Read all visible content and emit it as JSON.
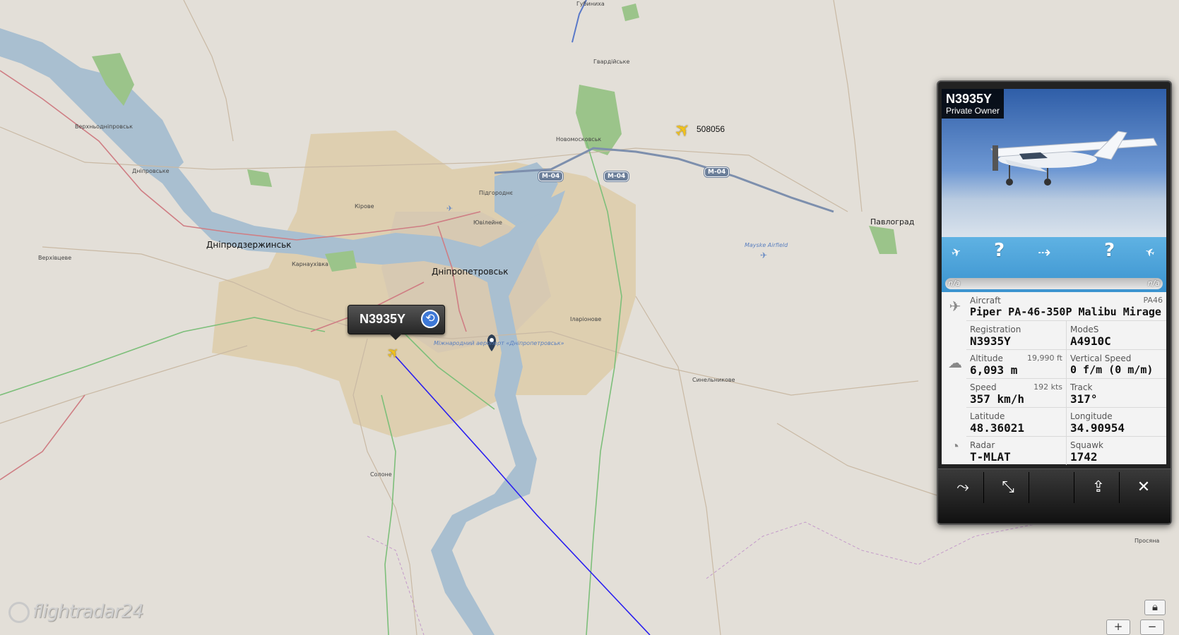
{
  "brand": {
    "logo_text": "flightradar24"
  },
  "map": {
    "cities": [
      {
        "name": "Губиниха"
      },
      {
        "name": "Гвардійське"
      },
      {
        "name": "Новомосковськ"
      },
      {
        "name": "Верхньодніпровськ"
      },
      {
        "name": "Дніпровське"
      },
      {
        "name": "Підгороднє"
      },
      {
        "name": "Кірове"
      },
      {
        "name": "Ювілейне"
      },
      {
        "name": "Дніпродзержинськ"
      },
      {
        "name": "Карнаухівка"
      },
      {
        "name": "Дніпропетровськ"
      },
      {
        "name": "Верхівцеве"
      },
      {
        "name": "Іларіонове"
      },
      {
        "name": "Павлоград"
      },
      {
        "name": "Синельникове"
      },
      {
        "name": "Солоне"
      },
      {
        "name": "Просяна"
      }
    ],
    "airfield": "Mayske Airfield",
    "airport": "Міжнародний аеропорт «Дніпропетровськ»",
    "road_shields": [
      "M-04",
      "M-04",
      "M-04"
    ]
  },
  "flights": {
    "other_callsign": "508056",
    "selected_callout": "N3935Y"
  },
  "panel": {
    "registration_title": "N3935Y",
    "owner": "Private Owner",
    "origin": "?",
    "destination": "?",
    "origin_time": "n/a",
    "dest_time": "n/a",
    "aircraft_label": "Aircraft",
    "aircraft_code": "PA46",
    "aircraft_name": "Piper PA-46-350P Malibu Mirage",
    "registration_label": "Registration",
    "registration": "N3935Y",
    "modes_label": "ModeS",
    "modes": "A4910C",
    "altitude_label": "Altitude",
    "altitude_ft": "19,990 ft",
    "altitude_m": "6,093 m",
    "vspeed_label": "Vertical Speed",
    "vspeed": "0 f/m (0 m/m)",
    "speed_label": "Speed",
    "speed_kts": "192 kts",
    "speed_kmh": "357 km/h",
    "track_label": "Track",
    "track": "317°",
    "lat_label": "Latitude",
    "lat": "48.36021",
    "lon_label": "Longitude",
    "lon": "34.90954",
    "radar_label": "Radar",
    "radar": "T-MLAT",
    "squawk_label": "Squawk",
    "squawk": "1742"
  },
  "toolbar": {
    "route_icon": "route-icon",
    "collapse_icon": "collapse-icon",
    "share_icon": "share-icon",
    "close_icon": "close-icon"
  },
  "zoom": {
    "plus": "+",
    "minus": "−"
  },
  "colors": {
    "track_line": "#2a1ff0",
    "panel_accent": "#3b93cf",
    "map_bg": "#e3dfd8",
    "water": "#a9bfd0"
  }
}
